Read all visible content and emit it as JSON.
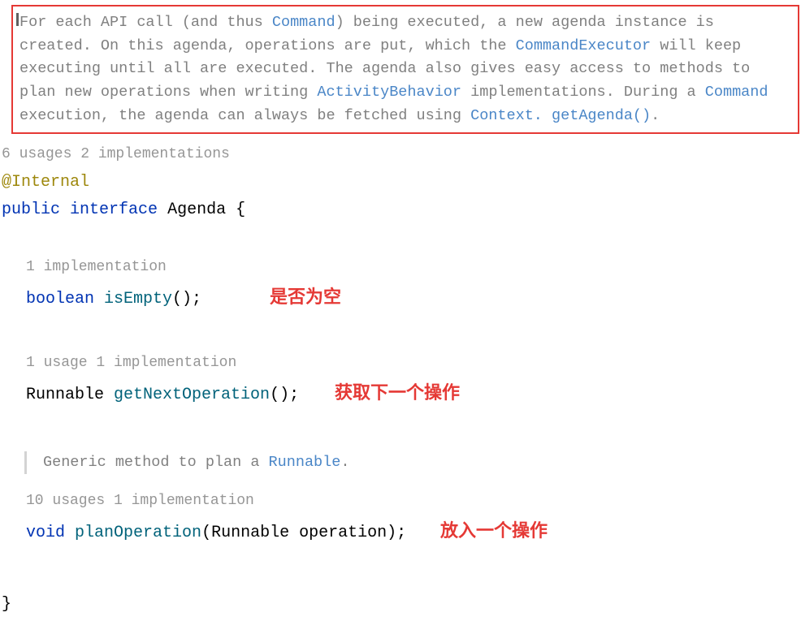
{
  "javadoc": {
    "part1": "For each API call (and thus ",
    "link1": "Command",
    "part2": ") being executed, a new agenda instance is created. On this agenda, operations are put, which the ",
    "link2": "CommandExecutor",
    "part3": " will keep executing until all are executed. The agenda also gives easy access to methods to plan new operations when writing ",
    "link3": "ActivityBehavior",
    "part4": " implementations. During a ",
    "link4": "Command",
    "part5": " execution, the agenda can always be fetched using ",
    "link5": "Context. getAgenda()",
    "part6": "."
  },
  "class_header": {
    "usages": "6 usages   2 implementations",
    "annotation": "@Internal",
    "kw_public": "public",
    "kw_interface": "interface",
    "class_name": "Agenda",
    "open_brace": "{"
  },
  "method1": {
    "usages": "1 implementation",
    "return_type": "boolean",
    "name": "isEmpty",
    "parens": "();",
    "comment": "是否为空"
  },
  "method2": {
    "usages": "1 usage   1 implementation",
    "return_type": "Runnable",
    "name": "getNextOperation",
    "parens": "();",
    "comment": "获取下一个操作"
  },
  "inner_doc": {
    "part1": "Generic method to plan a ",
    "link1": "Runnable",
    "part2": "."
  },
  "method3": {
    "usages": "10 usages   1 implementation",
    "return_type": "void",
    "name": "planOperation",
    "param": "(Runnable operation);",
    "comment": "放入一个操作"
  },
  "close_brace": "}"
}
